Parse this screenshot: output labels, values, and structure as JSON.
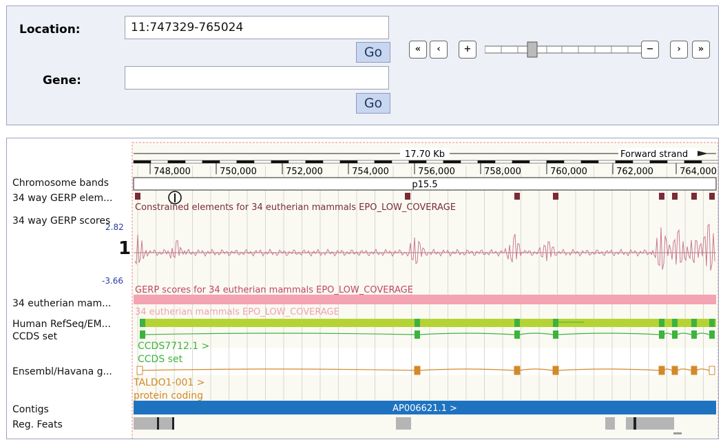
{
  "search": {
    "location_label": "Location:",
    "location_value": "11:747329-765024",
    "gene_label": "Gene:",
    "gene_value": "",
    "go_label": "Go",
    "go2_label": "Go"
  },
  "nav": {
    "first": "«",
    "prev": "‹",
    "zoom_in": "+",
    "zoom_out": "−",
    "next": "›",
    "last": "»"
  },
  "ruler": {
    "length": "17.70 Kb",
    "strand": "Forward strand",
    "ticks": [
      "748,000",
      "750,000",
      "752,000",
      "754,000",
      "756,000",
      "758,000",
      "760,000",
      "762,000",
      "764,000"
    ]
  },
  "tracks": {
    "chrom_bands": "Chromosome bands",
    "band_name": "p15.5",
    "gerp_elements": "34 way GERP elem...",
    "gerp_elements_caption": "Constrained elements for 34 eutherian mammals EPO_LOW_COVERAGE",
    "gerp_scores": "34 way GERP scores",
    "score_max": "2.82",
    "score_zero": "1",
    "score_min": "-3.66",
    "gerp_scores_caption": "GERP scores for 34 eutherian mammals EPO_LOW_COVERAGE",
    "eutherian": "34 eutherian mam...",
    "eutherian_caption": "34 eutherian mammals EPO_LOW_COVERAGE",
    "refseq": "Human RefSeq/EM...",
    "ccds": "CCDS set",
    "ccds_transcript": "CCDS7712.1 >",
    "ccds_caption": "CCDS set",
    "ensembl": "Ensembl/Havana g...",
    "ensembl_transcript": "TALDO1-001 >",
    "ensembl_caption": "protein coding",
    "contigs": "Contigs",
    "contig_name": "AP006621.1 >",
    "regfeats": "Reg. Feats"
  },
  "colors": {
    "gerp_element": "#7a2b35",
    "gerp_score": "#c97a8c",
    "pink_bar": "#f4a3b2",
    "refseq": "#b5d334",
    "ccds": "#3db33d",
    "ensembl": "#d3892a",
    "contig": "#1e73c0",
    "regfeat": "#b5b5b5"
  }
}
